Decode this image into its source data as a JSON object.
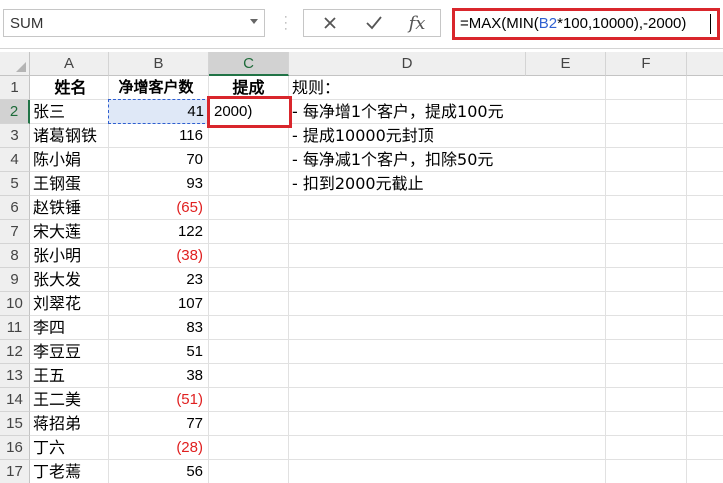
{
  "name_box": {
    "value": "SUM"
  },
  "formula_bar": {
    "cancel_icon": "x-icon",
    "enter_icon": "check-icon",
    "fx_label": "fx",
    "formula_prefix": "=MAX(MIN(",
    "formula_ref": "B2",
    "formula_suffix": "*100,10000),-2000)"
  },
  "columns": [
    "A",
    "B",
    "C",
    "D",
    "E",
    "F"
  ],
  "rows": [
    "1",
    "2",
    "3",
    "4",
    "5",
    "6",
    "7",
    "8",
    "9",
    "10",
    "11",
    "12",
    "13",
    "14",
    "15",
    "16",
    "17"
  ],
  "headers": {
    "a1": "姓名",
    "b1": "净增客户数",
    "c1": "提成"
  },
  "active_cell_edit": "2000)",
  "rules": {
    "title": "规则：",
    "lines": [
      "- 每净增1个客户，提成100元",
      "- 提成10000元封顶",
      "- 每净减1个客户，扣除50元",
      "- 扣到2000元截止"
    ]
  },
  "data_rows": [
    {
      "name": "张三",
      "value": "41",
      "negative": false
    },
    {
      "name": "诸葛钢铁",
      "value": "116",
      "negative": false
    },
    {
      "name": "陈小娟",
      "value": "70",
      "negative": false
    },
    {
      "name": "王钢蛋",
      "value": "93",
      "negative": false
    },
    {
      "name": "赵铁锤",
      "value": "(65)",
      "negative": true
    },
    {
      "name": "宋大莲",
      "value": "122",
      "negative": false
    },
    {
      "name": "张小明",
      "value": "(38)",
      "negative": true
    },
    {
      "name": "张大发",
      "value": "23",
      "negative": false
    },
    {
      "name": "刘翠花",
      "value": "107",
      "negative": false
    },
    {
      "name": "李四",
      "value": "83",
      "negative": false
    },
    {
      "name": "李豆豆",
      "value": "51",
      "negative": false
    },
    {
      "name": "王五",
      "value": "38",
      "negative": false
    },
    {
      "name": "王二美",
      "value": "(51)",
      "negative": true
    },
    {
      "name": "蒋招弟",
      "value": "77",
      "negative": false
    },
    {
      "name": "丁六",
      "value": "(28)",
      "negative": true
    },
    {
      "name": "丁老蔫",
      "value": "56",
      "negative": false
    }
  ],
  "colors": {
    "negative": "#e02020",
    "reference": "#2f5fd0",
    "highlight_box": "#d9262c",
    "selection": "#217346"
  }
}
